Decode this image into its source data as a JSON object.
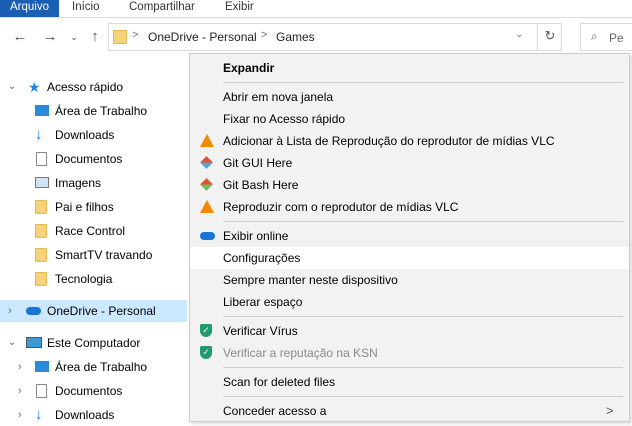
{
  "ribbon": {
    "tabs": [
      "Arquivo",
      "Início",
      "Compartilhar",
      "Exibir"
    ]
  },
  "address": {
    "crumbs": [
      "OneDrive - Personal",
      "Games"
    ],
    "separator": ">",
    "search_placeholder": "Pe"
  },
  "nav": {
    "quick_access": "Acesso rápido",
    "quick_items": [
      "Área de Trabalho",
      "Downloads",
      "Documentos",
      "Imagens",
      "Pai e filhos",
      "Race Control",
      "SmartTV travando",
      "Tecnologia"
    ],
    "onedrive": "OneDrive - Personal",
    "this_pc": "Este Computador",
    "pc_items": [
      "Área de Trabalho",
      "Documentos",
      "Downloads"
    ]
  },
  "menu": {
    "items": [
      {
        "label": "Expandir"
      },
      {
        "label": "Abrir em nova janela"
      },
      {
        "label": "Fixar no Acesso rápido"
      },
      {
        "label": "Adicionar à Lista de Reprodução do reprodutor de mídias VLC"
      },
      {
        "label": "Git GUI Here"
      },
      {
        "label": "Git Bash Here"
      },
      {
        "label": "Reproduzir com o reprodutor de mídias VLC"
      },
      {
        "label": "Exibir online"
      },
      {
        "label": "Configurações"
      },
      {
        "label": "Sempre manter neste dispositivo"
      },
      {
        "label": "Liberar espaço"
      },
      {
        "label": "Verificar Vírus"
      },
      {
        "label": "Verificar a reputação na KSN"
      },
      {
        "label": "Scan for deleted files"
      },
      {
        "label": "Conceder acesso a"
      }
    ],
    "submenu_arrow": ">"
  },
  "colors": {
    "accent": "#1a5fb4",
    "selected_nav": "#cce8ff",
    "menu_bg": "#f2f2f2"
  }
}
